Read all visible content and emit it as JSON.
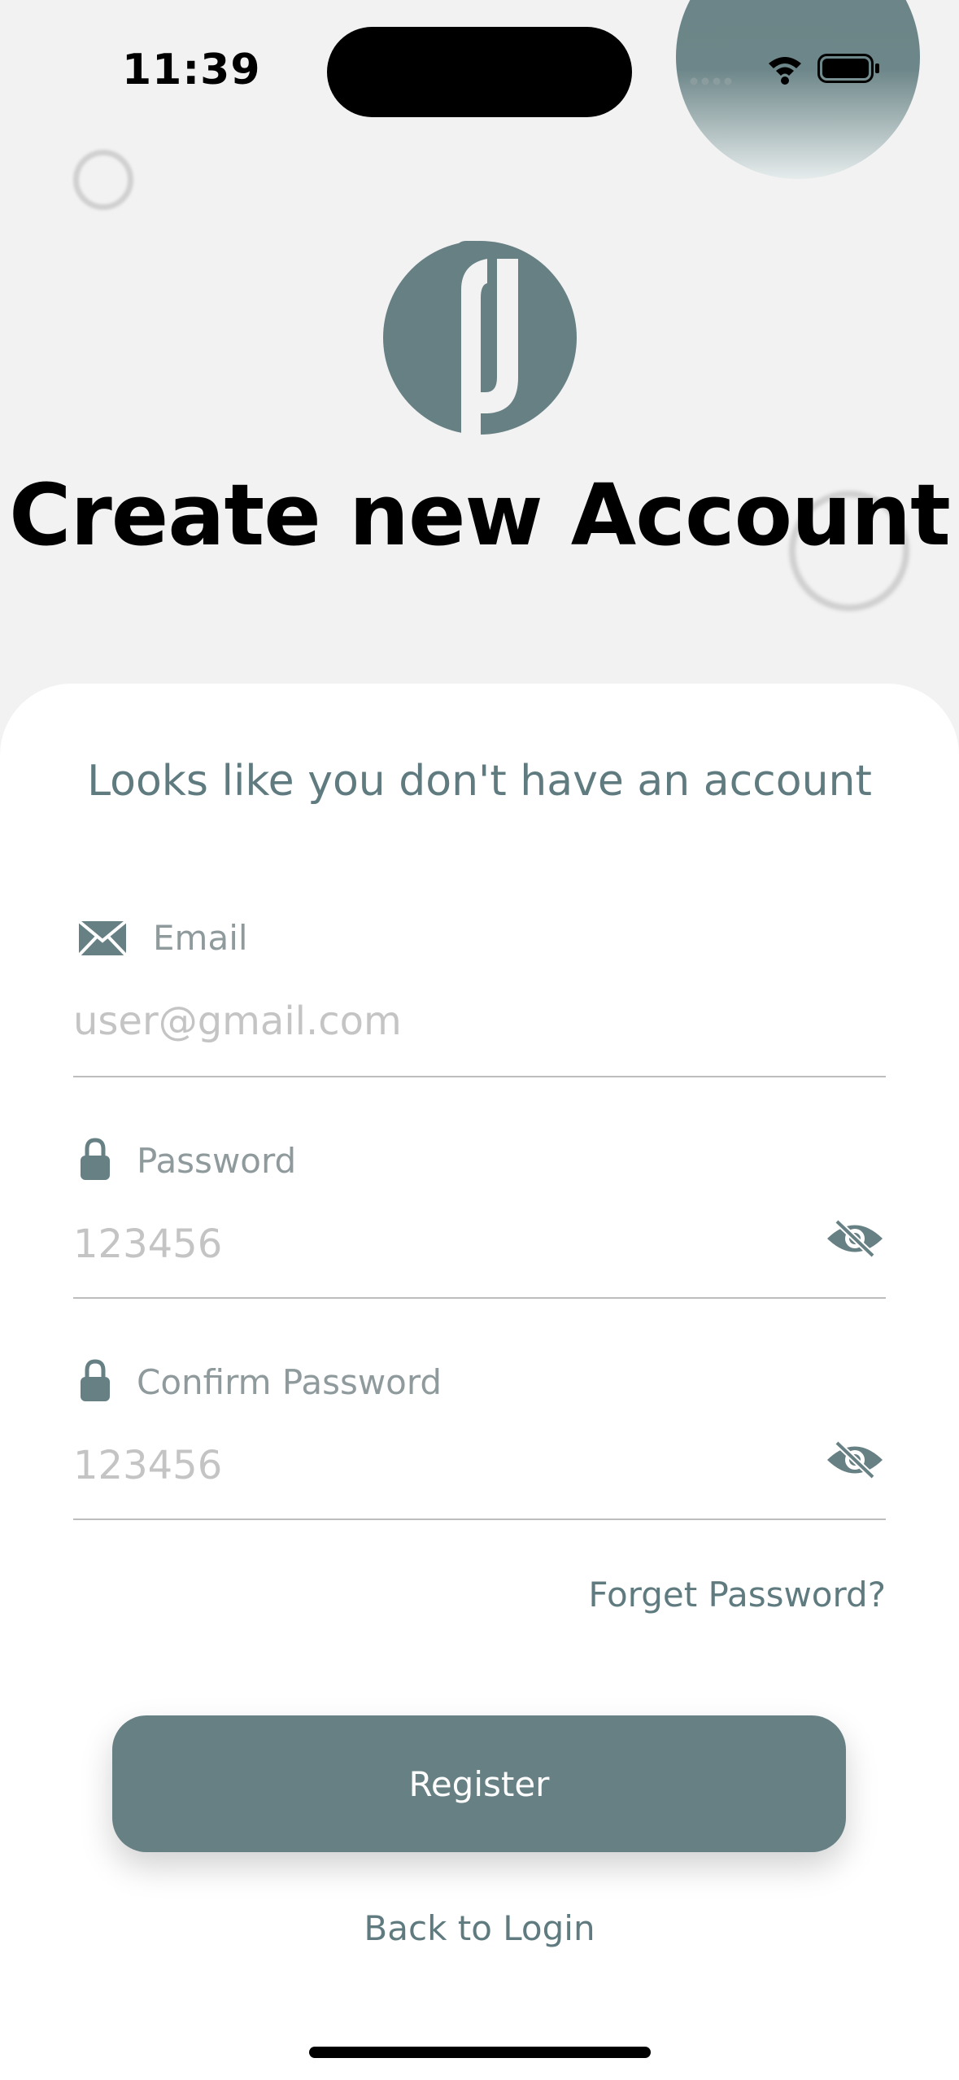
{
  "status_bar": {
    "time": "11:39"
  },
  "header": {
    "title": "Create new Account"
  },
  "form": {
    "subtitle": "Looks like you don't have an account",
    "email": {
      "label": "Email",
      "placeholder": "user@gmail.com",
      "icon": "envelope-icon"
    },
    "password": {
      "label": "Password",
      "placeholder": "123456",
      "icon": "lock-icon",
      "toggle_icon": "eye-slash-icon"
    },
    "confirm_password": {
      "label": "Confirm Password",
      "placeholder": "123456",
      "icon": "lock-icon",
      "toggle_icon": "eye-slash-icon"
    },
    "forgot_label": "Forget Password?",
    "register_label": "Register",
    "back_label": "Back to Login"
  },
  "colors": {
    "accent": "#678084",
    "accent_text": "#5f7b7f",
    "background": "#f2f2f2",
    "card": "#ffffff"
  }
}
